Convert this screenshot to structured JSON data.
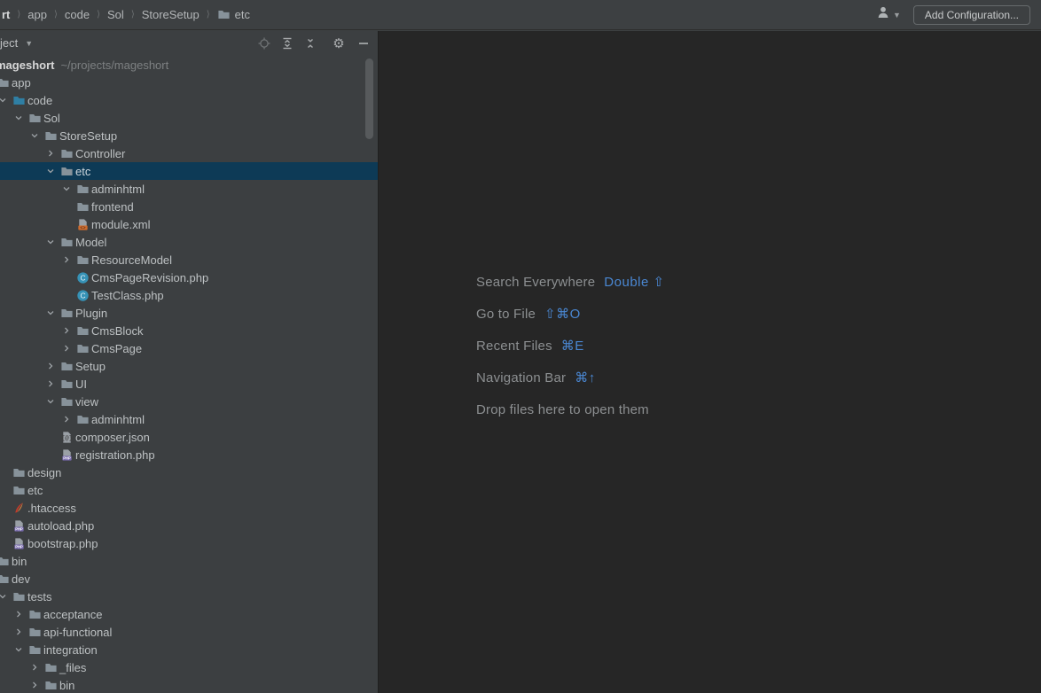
{
  "topbar": {
    "breadcrumbs": [
      {
        "label": "rt",
        "bold": true
      },
      {
        "label": "app"
      },
      {
        "label": "code"
      },
      {
        "label": "Sol"
      },
      {
        "label": "StoreSetup"
      },
      {
        "label": "etc",
        "icon": "folder"
      }
    ],
    "user_icon": "user-silhouette-icon",
    "add_configuration_label": "Add Configuration..."
  },
  "project_panel": {
    "header": {
      "title": "ject",
      "icons": [
        "locate-icon",
        "expand-all-icon",
        "collapse-all-icon",
        "settings-gear-icon",
        "hide-panel-icon"
      ]
    },
    "tree": [
      {
        "type": "root",
        "level": 0,
        "name": "mageshort",
        "path": "~/projects/mageshort"
      },
      {
        "level": 1,
        "chevron": null,
        "icon": "folder",
        "label": "app"
      },
      {
        "level": 2,
        "chevron": "down",
        "icon": "folder-source",
        "label": "code"
      },
      {
        "level": 3,
        "chevron": "down",
        "icon": "folder",
        "label": "Sol"
      },
      {
        "level": 4,
        "chevron": "down",
        "icon": "folder",
        "label": "StoreSetup"
      },
      {
        "level": 5,
        "chevron": "right",
        "icon": "folder",
        "label": "Controller"
      },
      {
        "level": 5,
        "chevron": "down",
        "icon": "folder",
        "label": "etc",
        "selected": true
      },
      {
        "level": 6,
        "chevron": "down",
        "icon": "folder",
        "label": "adminhtml"
      },
      {
        "level": 6,
        "chevron": null,
        "icon": "folder",
        "label": "frontend"
      },
      {
        "level": 6,
        "chevron": null,
        "icon": "xml",
        "label": "module.xml"
      },
      {
        "level": 5,
        "chevron": "down",
        "icon": "folder",
        "label": "Model"
      },
      {
        "level": 6,
        "chevron": "right",
        "icon": "folder",
        "label": "ResourceModel"
      },
      {
        "level": 6,
        "chevron": null,
        "icon": "class",
        "label": "CmsPageRevision.php"
      },
      {
        "level": 6,
        "chevron": null,
        "icon": "class",
        "label": "TestClass.php"
      },
      {
        "level": 5,
        "chevron": "down",
        "icon": "folder",
        "label": "Plugin"
      },
      {
        "level": 6,
        "chevron": "right",
        "icon": "folder",
        "label": "CmsBlock"
      },
      {
        "level": 6,
        "chevron": "right",
        "icon": "folder",
        "label": "CmsPage"
      },
      {
        "level": 5,
        "chevron": "right",
        "icon": "folder",
        "label": "Setup"
      },
      {
        "level": 5,
        "chevron": "right",
        "icon": "folder",
        "label": "UI"
      },
      {
        "level": 5,
        "chevron": "down",
        "icon": "folder",
        "label": "view"
      },
      {
        "level": 6,
        "chevron": "right",
        "icon": "folder",
        "label": "adminhtml"
      },
      {
        "level": 5,
        "chevron": null,
        "icon": "json",
        "label": "composer.json"
      },
      {
        "level": 5,
        "chevron": null,
        "icon": "php",
        "label": "registration.php"
      },
      {
        "level": 2,
        "chevron": null,
        "icon": "folder",
        "label": "design"
      },
      {
        "level": 2,
        "chevron": null,
        "icon": "folder",
        "label": "etc"
      },
      {
        "level": 2,
        "chevron": null,
        "icon": "htaccess",
        "label": ".htaccess"
      },
      {
        "level": 2,
        "chevron": null,
        "icon": "php",
        "label": "autoload.php"
      },
      {
        "level": 2,
        "chevron": null,
        "icon": "php",
        "label": "bootstrap.php"
      },
      {
        "level": 1,
        "chevron": null,
        "icon": "folder",
        "label": "bin"
      },
      {
        "level": 1,
        "chevron": null,
        "icon": "folder",
        "label": "dev"
      },
      {
        "level": 2,
        "chevron": "down",
        "icon": "folder",
        "label": "tests"
      },
      {
        "level": 3,
        "chevron": "right",
        "icon": "folder",
        "label": "acceptance"
      },
      {
        "level": 3,
        "chevron": "right",
        "icon": "folder",
        "label": "api-functional"
      },
      {
        "level": 3,
        "chevron": "down",
        "icon": "folder",
        "label": "integration"
      },
      {
        "level": 4,
        "chevron": "right",
        "icon": "folder",
        "label": "_files"
      },
      {
        "level": 4,
        "chevron": "right",
        "icon": "folder",
        "label": "bin"
      }
    ]
  },
  "editor": {
    "shortcuts": [
      {
        "label": "Search Everywhere",
        "keys": "Double ⇧"
      },
      {
        "label": "Go to File",
        "keys": "⇧⌘O"
      },
      {
        "label": "Recent Files",
        "keys": "⌘E"
      },
      {
        "label": "Navigation Bar",
        "keys": "⌘↑"
      },
      {
        "label": "Drop files here to open them",
        "keys": ""
      }
    ]
  },
  "colors": {
    "panel_background": "#3c3f41",
    "editor_background": "#262626",
    "selection_blue": "#0d3a56",
    "shortcut_key_blue": "#4a87d2",
    "folder_gray": "#87929a",
    "source_folder_teal": "#2f7fa4",
    "class_icon_teal": "#3692b6",
    "xml_icon_orange": "#cf6b2d",
    "php_icon_purple": "#7668ab",
    "apache_icon_red": "#c23b2a"
  }
}
